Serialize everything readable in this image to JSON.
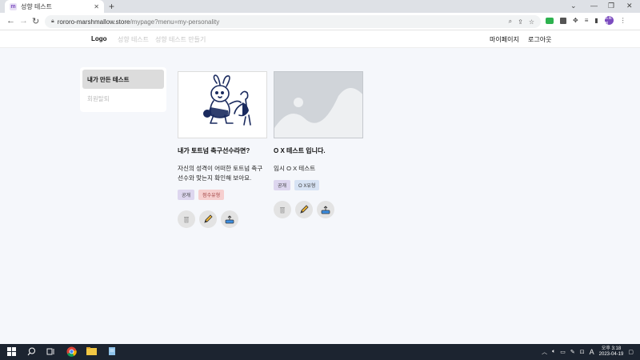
{
  "browser": {
    "tab_title": "성향 테스트",
    "tab_favicon": "m",
    "url_host": "rororo-marshmallow.store",
    "url_path": "/mypage?menu=my-personality",
    "profile_initials": "프로필"
  },
  "header": {
    "logo": "Logo",
    "nav": [
      "성향 테스트",
      "성향 테스트 만들기"
    ],
    "right": [
      "마이페이지",
      "로그아웃"
    ]
  },
  "sidebar": {
    "items": [
      {
        "label": "내가 만든 테스트"
      },
      {
        "label": "회원탈퇴"
      }
    ]
  },
  "cards": [
    {
      "title": "내가 토트넘 축구선수라면?",
      "desc": "자신의 성격이 어떠한 토트넘 축구선수와 맞는지 확인해 보아요.",
      "tags": [
        "공개",
        "점수유형"
      ]
    },
    {
      "title": "O X 테스트 입니다.",
      "desc": "임시 O X 테스트",
      "tags": [
        "공개",
        "O X유형"
      ]
    }
  ],
  "taskbar": {
    "time": "오후 3:18",
    "date": "2023-04-19",
    "ime": "A"
  },
  "colors": {
    "page_bg": "#f5f7fb",
    "tag_public": "#d7e3f4",
    "tag_score": "#f6cfcf",
    "tag_ox": "#ddd6ef"
  }
}
